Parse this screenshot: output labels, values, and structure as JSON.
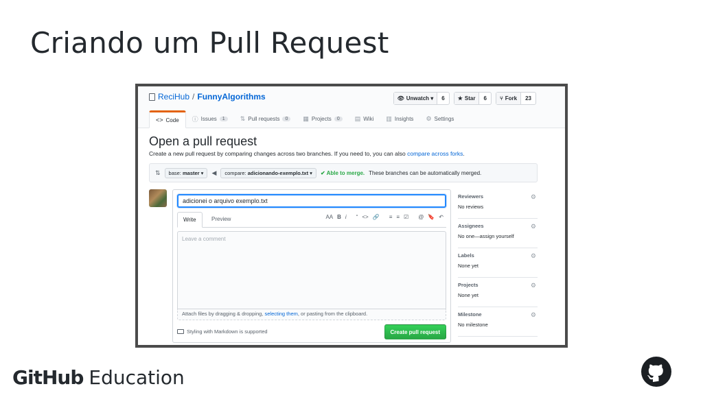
{
  "slide": {
    "title": "Criando um Pull Request",
    "footer_brand": "GitHub",
    "footer_product": "Education"
  },
  "repo": {
    "owner": "ReciHub",
    "separator": "/",
    "name": "FunnyAlgorithms",
    "actions": [
      {
        "icon": "eye-icon",
        "glyph": "👁",
        "label": "Unwatch ▾",
        "count": "6"
      },
      {
        "icon": "star-icon",
        "glyph": "★",
        "label": "Star",
        "count": "6"
      },
      {
        "icon": "fork-icon",
        "glyph": "⑂",
        "label": "Fork",
        "count": "23"
      }
    ],
    "tabs": [
      {
        "icon": "code-icon",
        "glyph": "<>",
        "label": "Code",
        "counter": "",
        "selected": true
      },
      {
        "icon": "issue-icon",
        "glyph": "ⓘ",
        "label": "Issues",
        "counter": "1"
      },
      {
        "icon": "pull-request-icon",
        "glyph": "⇅",
        "label": "Pull requests",
        "counter": "0"
      },
      {
        "icon": "project-icon",
        "glyph": "▦",
        "label": "Projects",
        "counter": "0"
      },
      {
        "icon": "wiki-icon",
        "glyph": "▤",
        "label": "Wiki",
        "counter": ""
      },
      {
        "icon": "graph-icon",
        "glyph": "▥",
        "label": "Insights",
        "counter": ""
      },
      {
        "icon": "gear-icon",
        "glyph": "⚙",
        "label": "Settings",
        "counter": ""
      }
    ]
  },
  "compare": {
    "heading": "Open a pull request",
    "subtitle": "Create a new pull request by comparing changes across two branches. If you need to, you can also ",
    "subtitle_link": "compare across forks",
    "subtitle_end": ".",
    "base_prefix": "base: ",
    "base_branch": "master",
    "compare_prefix": "compare: ",
    "compare_branch": "adicionando-exemplo.txt",
    "merge_status": "✔ Able to merge.",
    "merge_text": "These branches can be automatically merged."
  },
  "composer": {
    "title_value": "adicionei o arquivo exemplo.txt",
    "tab_write": "Write",
    "tab_preview": "Preview",
    "toolbar": [
      "AA",
      "B",
      "i",
      "“",
      "<>",
      "🔗",
      "≡",
      "≡",
      "☑",
      "@",
      "🔖",
      "↶"
    ],
    "textarea_placeholder": "Leave a comment",
    "attach_text_1": "Attach files by dragging & dropping, ",
    "attach_link": "selecting them",
    "attach_text_2": ", or pasting from the clipboard.",
    "markdown_note": "Styling with Markdown is supported",
    "submit_label": "Create pull request"
  },
  "sidebar": [
    {
      "heading": "Reviewers",
      "value": "No reviews"
    },
    {
      "heading": "Assignees",
      "value": "No one—assign yourself"
    },
    {
      "heading": "Labels",
      "value": "None yet"
    },
    {
      "heading": "Projects",
      "value": "None yet"
    },
    {
      "heading": "Milestone",
      "value": "No milestone"
    }
  ],
  "colors": {
    "accent_blue": "#0366d6",
    "success_green": "#28a745",
    "tab_orange": "#e36209"
  }
}
